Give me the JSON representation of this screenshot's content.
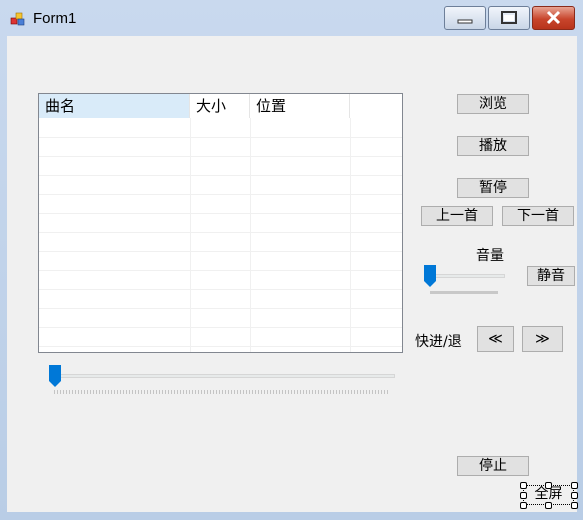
{
  "window": {
    "title": "Form1"
  },
  "playlist": {
    "columns": [
      "曲名",
      "大小",
      "位置"
    ],
    "rows": []
  },
  "buttons": {
    "browse": "浏览",
    "play": "播放",
    "pause": "暂停",
    "prev": "上一首",
    "next": "下一首",
    "mute": "静音",
    "rewind": "≪",
    "forward": "≫",
    "stop": "停止",
    "fullscreen": "全屏"
  },
  "labels": {
    "volume": "音量",
    "seek": "快进/退"
  },
  "sliders": {
    "volume_level": 0,
    "progress_level": 0
  },
  "colors": {
    "accent": "#0078d7",
    "close_button": "#c8452c"
  }
}
